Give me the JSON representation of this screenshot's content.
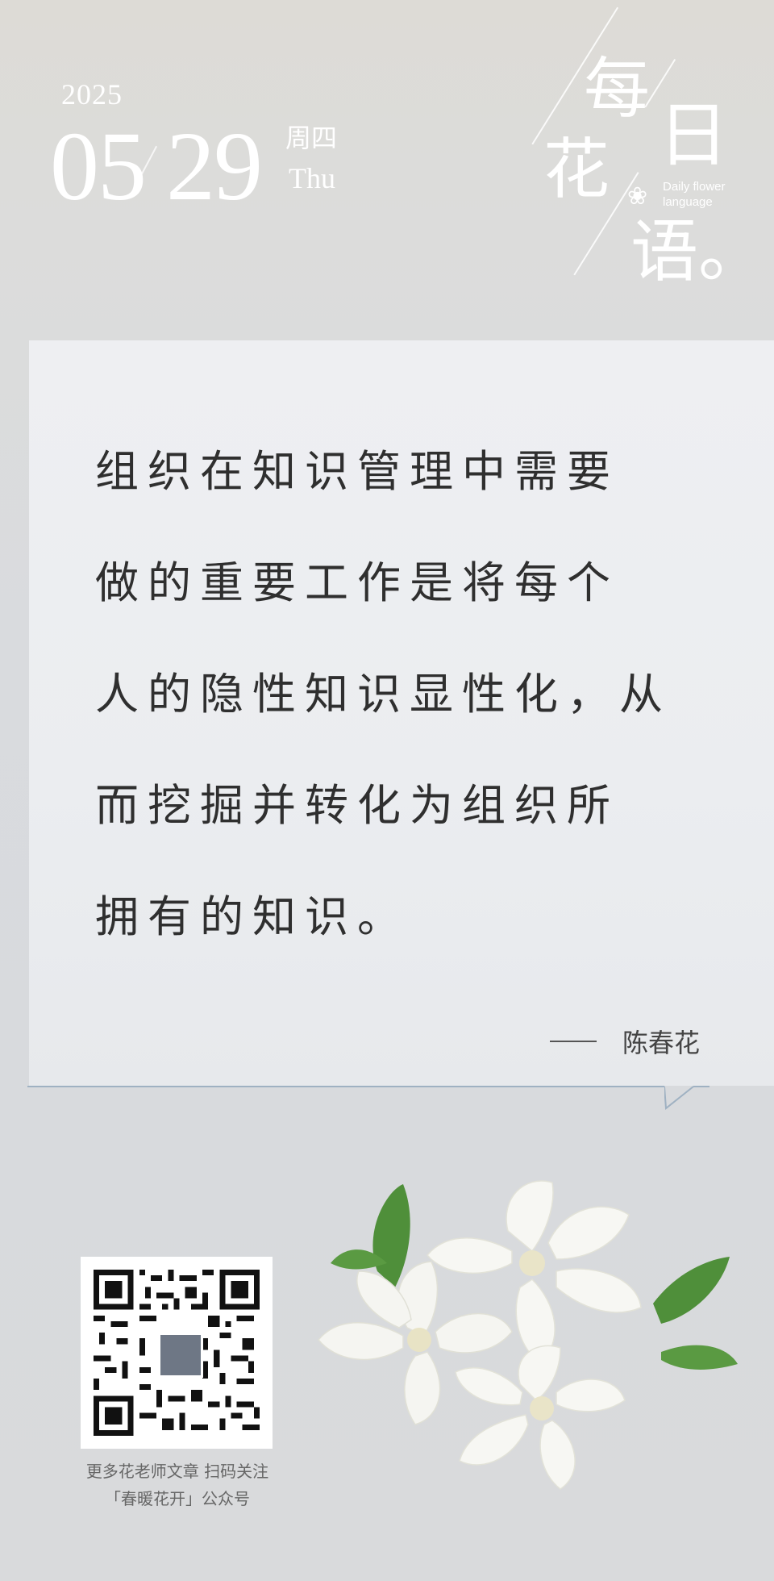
{
  "date": {
    "year": "2025",
    "month": "05",
    "day": "29",
    "weekday_cn": "周四",
    "weekday_en": "Thu"
  },
  "title": {
    "char1": "每",
    "char2": "日",
    "char3": "花",
    "char4": "语。",
    "subtitle_en_1": "Daily flower",
    "subtitle_en_2": "language"
  },
  "quote": {
    "lines": [
      "组织在知识管理中需要",
      "做的重要工作是将每个",
      "人的隐性知识显性化，从",
      "而挖掘并转化为组织所",
      "拥有的知识。"
    ],
    "author": "陈春花"
  },
  "qr": {
    "caption_line1": "更多花老师文章 扫码关注",
    "caption_line2": "「春暖花开」公众号"
  },
  "colors": {
    "card_accent": "#9fb1c2",
    "text": "#2f2f2f"
  },
  "icons": {
    "title_flower": "flower-icon",
    "flowers_image": "jasmine-flowers"
  }
}
